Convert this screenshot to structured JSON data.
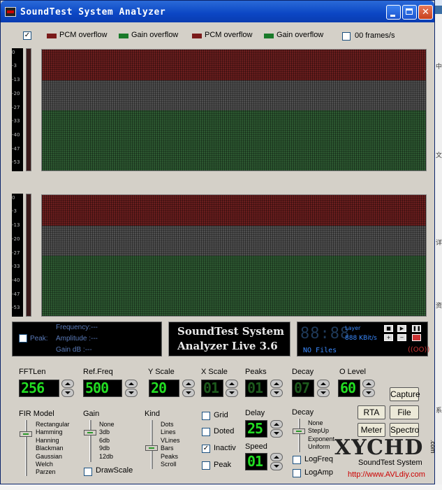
{
  "window": {
    "title": "SoundTest System Analyzer",
    "min_glyph": "",
    "max_glyph": "",
    "close_glyph": "✕"
  },
  "legend": {
    "main_checked": "✓",
    "items": [
      {
        "label": "PCM overflow",
        "color": "#7a1a1a"
      },
      {
        "label": "Gain overflow",
        "color": "#1a7a2a"
      },
      {
        "label": "PCM overflow",
        "color": "#7a1a1a"
      },
      {
        "label": "Gain overflow",
        "color": "#1a7a2a"
      }
    ],
    "frames_label": "00 frames/s"
  },
  "scale_labels": [
    "0",
    "-3",
    "-13",
    "-20",
    "-27",
    "-33",
    "-40",
    "-47",
    "-53"
  ],
  "info": {
    "peak_label": "Peak:",
    "frequency": "Frequency:---",
    "amplitude": "Amplitude :---",
    "gain": "Gain dB   :---"
  },
  "brand": {
    "line1": "SoundTest System",
    "line2": "Analyzer Live 3.6"
  },
  "player": {
    "lcd": "88:88",
    "layer": "Layer",
    "kbits": "888 KBit/s",
    "nofiles": "NO Files",
    "btn_stop": "■",
    "btn_play": "▶",
    "btn_pause": "❚❚",
    "btn_plus": "+",
    "btn_minus": "−",
    "oo": "((OO))"
  },
  "controls": {
    "fftlen": {
      "label": "FFTLen",
      "value": "256"
    },
    "reffreq": {
      "label": "Ref.Freq",
      "value": "500"
    },
    "yscale": {
      "label": "Y Scale",
      "value": "20"
    },
    "xscale": {
      "label": "X Scale",
      "value": "01"
    },
    "peaks": {
      "label": "Peaks",
      "value": "01"
    },
    "decay": {
      "label": "Decay",
      "value": "07"
    },
    "olevel": {
      "label": "O Level",
      "value": "60"
    },
    "delay": {
      "label": "Delay",
      "value": "25"
    },
    "speed": {
      "label": "Speed",
      "value": "01"
    },
    "fir_model": {
      "label": "FIR Model",
      "items": [
        "Rectangular",
        "Hamming",
        "Hanning",
        "Blackman",
        "Gaussian",
        "Welch",
        "Parzen"
      ]
    },
    "gain": {
      "label": "Gain",
      "items": [
        "None",
        "3db",
        "6db",
        "9db",
        "12db"
      ]
    },
    "kind": {
      "label": "Kind",
      "items": [
        "Dots",
        "Lines",
        "VLines",
        "Bars",
        "Peaks",
        "Scroll"
      ]
    },
    "decay_list": {
      "label": "Decay",
      "items": [
        "None",
        "StepUp",
        "Exponent",
        "Uniform"
      ]
    },
    "drawscale": "DrawScale",
    "grid": "Grid",
    "doted": "Doted",
    "inactiv": "Inactiv",
    "inactiv_check": "✓",
    "peak": "Peak",
    "logfreq": "LogFreq",
    "logamp": "LogAmp"
  },
  "buttons": {
    "capture": "Capture",
    "rta": "RTA",
    "file": "File",
    "meter": "Meter",
    "spectro": "Spectro"
  },
  "watermark": {
    "logo": "XYCHD",
    "dotcom": ".com",
    "sub": "SoundTest System",
    "url": "http://www.AVLdiy.com"
  },
  "right_edge_text": [
    "中",
    "文",
    "详",
    "资",
    "系"
  ]
}
